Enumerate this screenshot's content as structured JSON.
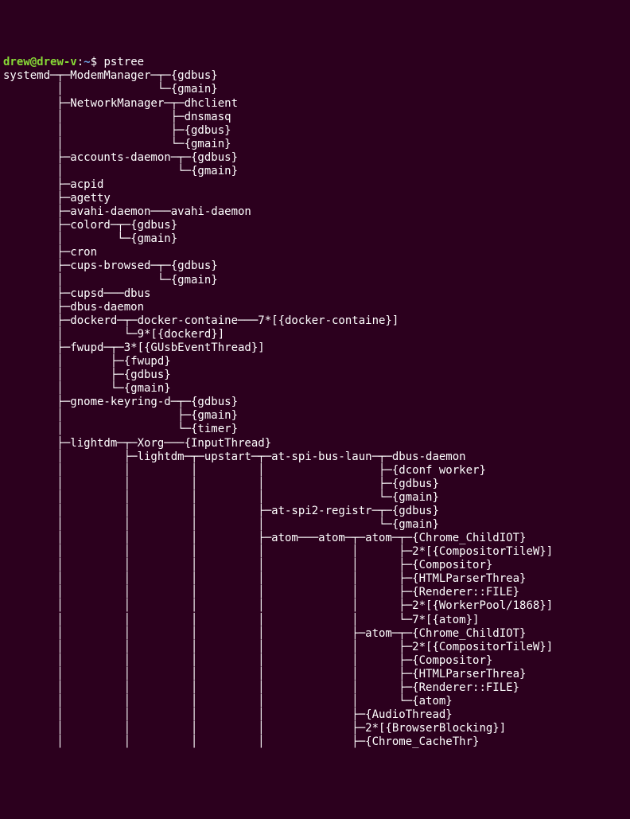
{
  "prompt": {
    "user": "drew",
    "at": "@",
    "host": "drew-v",
    "colon": ":",
    "path": "~",
    "dollar": "$",
    "command": "pstree"
  },
  "lines": [
    "systemd─┬─ModemManager─┬─{gdbus}",
    "        │              └─{gmain}",
    "        ├─NetworkManager─┬─dhclient",
    "        │                ├─dnsmasq",
    "        │                ├─{gdbus}",
    "        │                └─{gmain}",
    "        ├─accounts-daemon─┬─{gdbus}",
    "        │                 └─{gmain}",
    "        ├─acpid",
    "        ├─agetty",
    "        ├─avahi-daemon───avahi-daemon",
    "        ├─colord─┬─{gdbus}",
    "        │        └─{gmain}",
    "        ├─cron",
    "        ├─cups-browsed─┬─{gdbus}",
    "        │              └─{gmain}",
    "        ├─cupsd───dbus",
    "        ├─dbus-daemon",
    "        ├─dockerd─┬─docker-containe───7*[{docker-containe}]",
    "        │         └─9*[{dockerd}]",
    "        ├─fwupd─┬─3*[{GUsbEventThread}]",
    "        │       ├─{fwupd}",
    "        │       ├─{gdbus}",
    "        │       └─{gmain}",
    "        ├─gnome-keyring-d─┬─{gdbus}",
    "        │                 ├─{gmain}",
    "        │                 └─{timer}",
    "        ├─lightdm─┬─Xorg───{InputThread}",
    "        │         ├─lightdm─┬─upstart─┬─at-spi-bus-laun─┬─dbus-daemon",
    "        │         │         │         │                 ├─{dconf worker}",
    "        │         │         │         │                 ├─{gdbus}",
    "        │         │         │         │                 └─{gmain}",
    "        │         │         │         ├─at-spi2-registr─┬─{gdbus}",
    "        │         │         │         │                 └─{gmain}",
    "        │         │         │         ├─atom───atom─┬─atom─┬─{Chrome_ChildIOT}",
    "        │         │         │         │             │      ├─2*[{CompositorTileW}]",
    "        │         │         │         │             │      ├─{Compositor}",
    "        │         │         │         │             │      ├─{HTMLParserThrea}",
    "        │         │         │         │             │      ├─{Renderer::FILE}",
    "        │         │         │         │             │      ├─2*[{WorkerPool/1868}]",
    "        │         │         │         │             │      └─7*[{atom}]",
    "        │         │         │         │             ├─atom─┬─{Chrome_ChildIOT}",
    "        │         │         │         │             │      ├─2*[{CompositorTileW}]",
    "        │         │         │         │             │      ├─{Compositor}",
    "        │         │         │         │             │      ├─{HTMLParserThrea}",
    "        │         │         │         │             │      ├─{Renderer::FILE}",
    "        │         │         │         │             │      └─{atom}",
    "        │         │         │         │             ├─{AudioThread}",
    "        │         │         │         │             ├─2*[{BrowserBlocking}]",
    "        │         │         │         │             ├─{Chrome_CacheThr}"
  ]
}
